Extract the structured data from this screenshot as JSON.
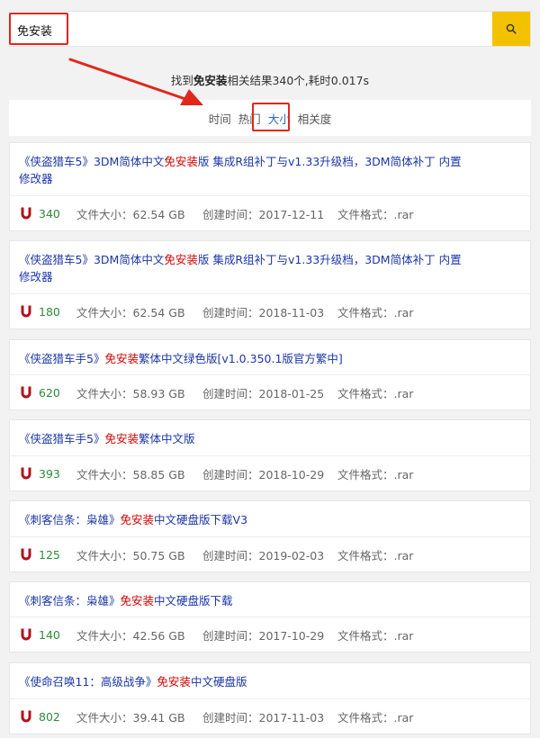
{
  "search": {
    "query": "免安装"
  },
  "result_info": {
    "prefix": "找到",
    "keyword": "免安装",
    "suffix": "相关结果340个,耗时0.017s"
  },
  "sort_options": [
    {
      "label": "时间",
      "active": false
    },
    {
      "label": "热门",
      "active": false
    },
    {
      "label": "大小",
      "active": true
    },
    {
      "label": "相关度",
      "active": false
    }
  ],
  "results": [
    {
      "title_before": "《侠盗猎车5》3DM简体中文",
      "keyword": "免安装",
      "title_after": "版 集成R组补丁与v1.33升级档，3DM简体补丁 内置修改器",
      "hot": "340",
      "size": "文件大小：62.54 GB",
      "created": "创建时间：2017-12-11",
      "format": "文件格式：.rar"
    },
    {
      "title_before": "《侠盗猎车5》3DM简体中文",
      "keyword": "免安装",
      "title_after": "版 集成R组补丁与v1.33升级档，3DM简体补丁 内置修改器",
      "hot": "180",
      "size": "文件大小：62.54 GB",
      "created": "创建时间：2018-11-03",
      "format": "文件格式：.rar"
    },
    {
      "title_before": "《侠盗猎车手5》",
      "keyword": "免安装",
      "title_after": "繁体中文绿色版[v1.0.350.1版官方繁中]",
      "hot": "620",
      "size": "文件大小：58.93 GB",
      "created": "创建时间：2018-01-25",
      "format": "文件格式：.rar"
    },
    {
      "title_before": "《侠盗猎车手5》",
      "keyword": "免安装",
      "title_after": "繁体中文版",
      "hot": "393",
      "size": "文件大小：58.85 GB",
      "created": "创建时间：2018-10-29",
      "format": "文件格式：.rar"
    },
    {
      "title_before": "《刺客信条：枭雄》",
      "keyword": "免安装",
      "title_after": "中文硬盘版下载V3",
      "hot": "125",
      "size": "文件大小：50.75 GB",
      "created": "创建时间：2019-02-03",
      "format": "文件格式：.rar"
    },
    {
      "title_before": "《刺客信条：枭雄》",
      "keyword": "免安装",
      "title_after": "中文硬盘版下载",
      "hot": "140",
      "size": "文件大小：42.56 GB",
      "created": "创建时间：2017-10-29",
      "format": "文件格式：.rar"
    },
    {
      "title_before": "《使命召唤11：高级战争》",
      "keyword": "免安装",
      "title_after": "中文硬盘版",
      "hot": "802",
      "size": "文件大小：39.41 GB",
      "created": "创建时间：2017-11-03",
      "format": "文件格式：.rar"
    }
  ],
  "colors": {
    "accent_button": "#f2c200",
    "highlight_red": "#e0271c",
    "link_blue": "#1a36a8",
    "keyword_red": "#d20000",
    "hot_green": "#2e8b3a"
  },
  "icons": {
    "search": "search-icon",
    "magnet": "magnet-icon"
  }
}
